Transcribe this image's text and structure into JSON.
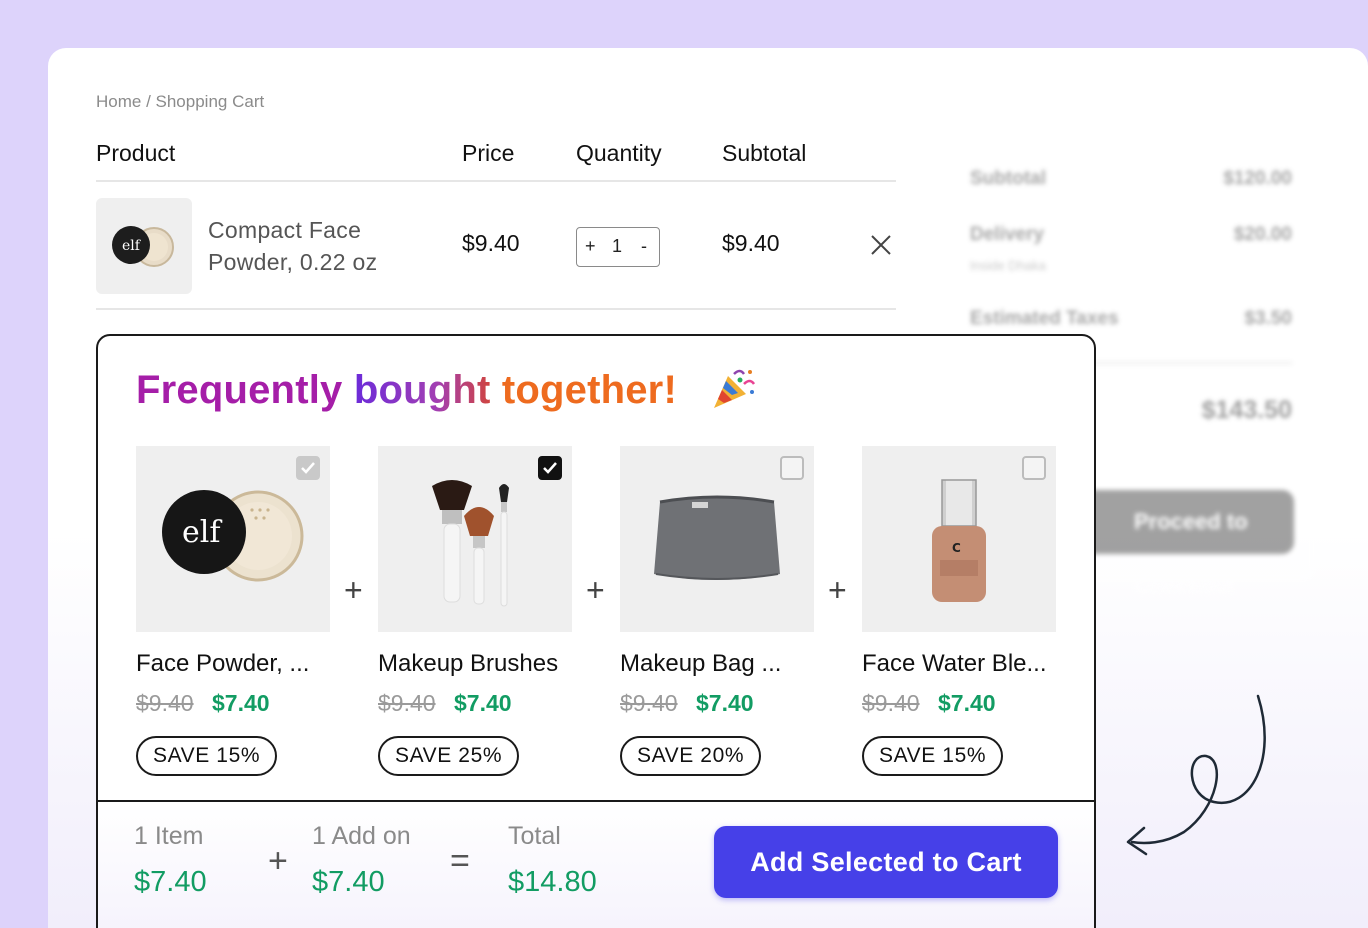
{
  "breadcrumb": "Home / Shopping Cart",
  "table": {
    "headers": {
      "product": "Product",
      "price": "Price",
      "quantity": "Quantity",
      "subtotal": "Subtotal"
    },
    "row": {
      "name": "Compact Face Powder, 0.22 oz",
      "price": "$9.40",
      "quantity": "1",
      "plus": "+",
      "minus": "-",
      "subtotal": "$9.40",
      "remove_icon": "close-icon"
    }
  },
  "summary": {
    "subtotal_label": "Subtotal",
    "subtotal_value": "$120.00",
    "delivery_label": "Delivery",
    "delivery_value": "$20.00",
    "delivery_sub": "Inside Dhaka",
    "taxes_label": "Estimated Taxes",
    "taxes_value": "$3.50",
    "total_value": "$143.50",
    "checkout_label": "Proceed to Checkout"
  },
  "fbt": {
    "title_1": "Frequently",
    "title_2": "bought",
    "title_3": "together!",
    "emoji": "party-popper-icon",
    "products": [
      {
        "name": "Face Powder, ...",
        "old_price": "$9.40",
        "new_price": "$7.40",
        "save": "SAVE 15%",
        "checkbox": "checked-disabled",
        "icon": "face-powder-image"
      },
      {
        "name": "Makeup Brushes",
        "old_price": "$9.40",
        "new_price": "$7.40",
        "save": "SAVE 25%",
        "checkbox": "checked",
        "icon": "makeup-brushes-image"
      },
      {
        "name": "Makeup Bag ...",
        "old_price": "$9.40",
        "new_price": "$7.40",
        "save": "SAVE 20%",
        "checkbox": "unchecked",
        "icon": "makeup-bag-image"
      },
      {
        "name": "Face Water Ble...",
        "old_price": "$9.40",
        "new_price": "$7.40",
        "save": "SAVE 15%",
        "checkbox": "unchecked",
        "icon": "foundation-bottle-image"
      }
    ],
    "plus_sign": "+",
    "footer": {
      "items_label": "1 Item",
      "items_value": "$7.40",
      "plus": "+",
      "addon_label": "1 Add on",
      "addon_value": "$7.40",
      "equals": "=",
      "total_label": "Total",
      "total_value": "$14.80",
      "button_label": "Add Selected to Cart"
    }
  },
  "colors": {
    "accent": "#4640e8",
    "discount": "#129c63",
    "background": "#ddd3fb"
  }
}
